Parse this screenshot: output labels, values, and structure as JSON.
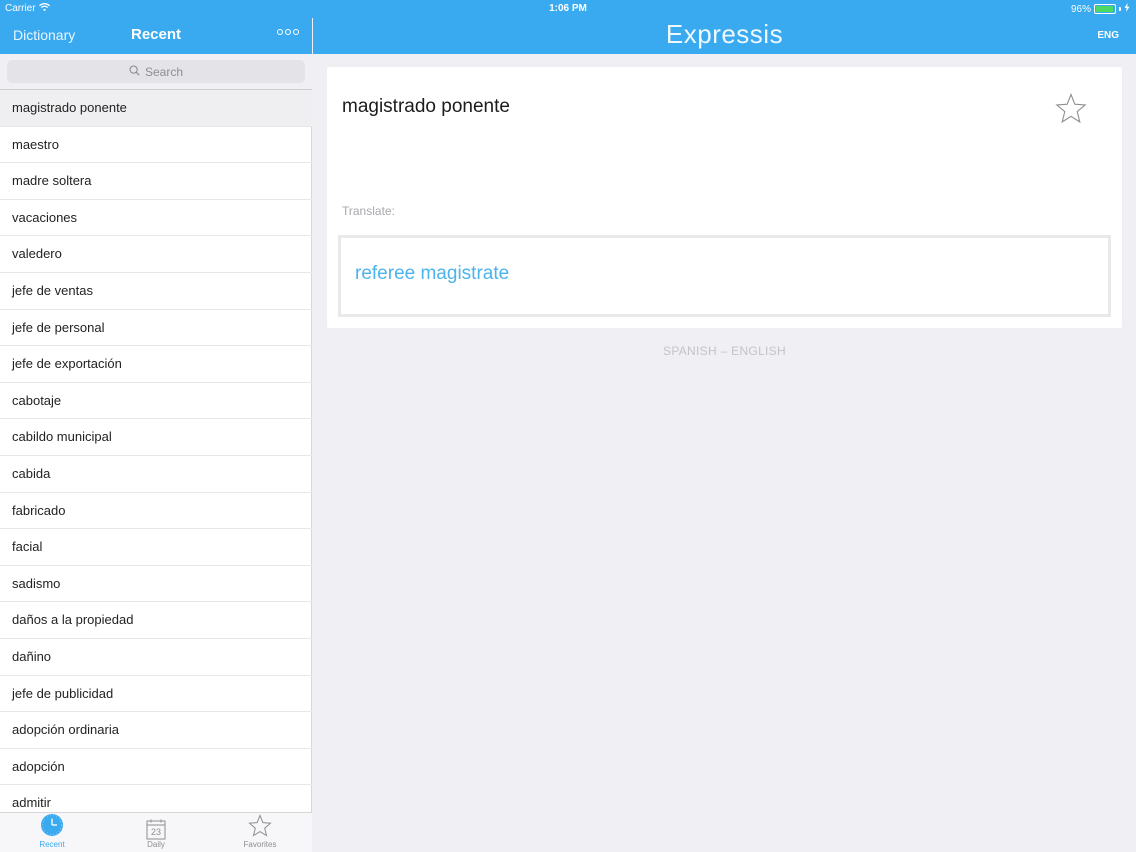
{
  "status_bar": {
    "carrier": "Carrier",
    "time": "1:06 PM",
    "battery": "96%",
    "battery_fraction": 0.96,
    "battery_color": "#4cd964"
  },
  "sidebar": {
    "nav": {
      "left_label": "Dictionary",
      "title": "Recent",
      "more_icon": "ellipsis-icon"
    },
    "search": {
      "placeholder": "Search",
      "icon": "search-icon"
    },
    "items": [
      {
        "label": "magistrado ponente",
        "selected": true
      },
      {
        "label": "maestro"
      },
      {
        "label": "madre soltera"
      },
      {
        "label": "vacaciones"
      },
      {
        "label": "valedero"
      },
      {
        "label": "jefe de ventas"
      },
      {
        "label": "jefe de personal"
      },
      {
        "label": "jefe de exportación"
      },
      {
        "label": "cabotaje"
      },
      {
        "label": "cabildo municipal"
      },
      {
        "label": "cabida"
      },
      {
        "label": "fabricado"
      },
      {
        "label": "facial"
      },
      {
        "label": "sadismo"
      },
      {
        "label": "daños a la propiedad"
      },
      {
        "label": "dañino"
      },
      {
        "label": "jefe de publicidad"
      },
      {
        "label": "adopción ordinaria"
      },
      {
        "label": "adopción"
      },
      {
        "label": "admitir"
      }
    ],
    "tabs": [
      {
        "label": "Recent",
        "icon": "clock-icon",
        "active": true
      },
      {
        "label": "Daily",
        "icon": "calendar-icon",
        "icon_text": "23"
      },
      {
        "label": "Favorites",
        "icon": "star-icon"
      }
    ]
  },
  "main": {
    "title": "Expressis",
    "language_button": "ENG",
    "term": "magistrado ponente",
    "favorite_icon": "star-outline-icon",
    "translate_label": "Translate:",
    "translation": "referee magistrate",
    "direction": "SPANISH – ENGLISH"
  },
  "colors": {
    "accent": "#39aaf0",
    "translation_text": "#4cb3ec"
  }
}
